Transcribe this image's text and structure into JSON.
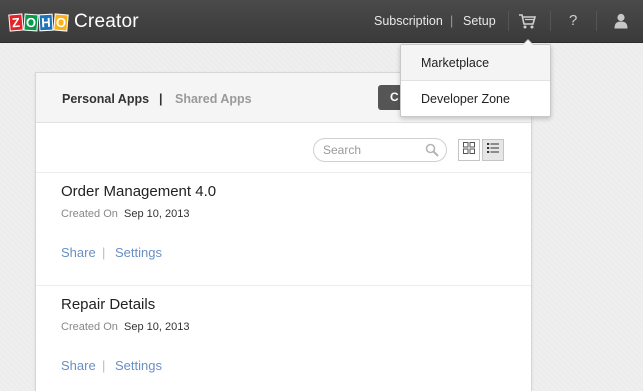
{
  "header": {
    "logo_letters": [
      "Z",
      "O",
      "H",
      "O"
    ],
    "logo_text": "Creator",
    "subscription": "Subscription",
    "separator": "|",
    "setup": "Setup",
    "help": "?"
  },
  "dropdown": {
    "items": [
      {
        "label": "Marketplace"
      },
      {
        "label": "Developer Zone"
      }
    ]
  },
  "tabs": {
    "personal": "Personal Apps",
    "separator": "|",
    "shared": "Shared Apps"
  },
  "create_button": "C",
  "search": {
    "placeholder": "Search",
    "value": ""
  },
  "apps": [
    {
      "name": "Order Management 4.0",
      "created_label": "Created On",
      "created_date": "Sep 10, 2013",
      "share": "Share",
      "separator": "|",
      "settings": "Settings"
    },
    {
      "name": "Repair Details",
      "created_label": "Created On",
      "created_date": "Sep 10, 2013",
      "share": "Share",
      "separator": "|",
      "settings": "Settings"
    }
  ],
  "icons": {
    "cart": "cart-icon",
    "help": "help-icon",
    "user": "user-icon",
    "search": "search-icon",
    "grid": "grid-view-icon",
    "list": "list-view-icon"
  },
  "colors": {
    "topbar": "#404040",
    "link": "#6a8fc4",
    "zoho_red": "#e42527",
    "zoho_green": "#089949",
    "zoho_blue": "#1f73b7",
    "zoho_yellow": "#f9b21d"
  }
}
